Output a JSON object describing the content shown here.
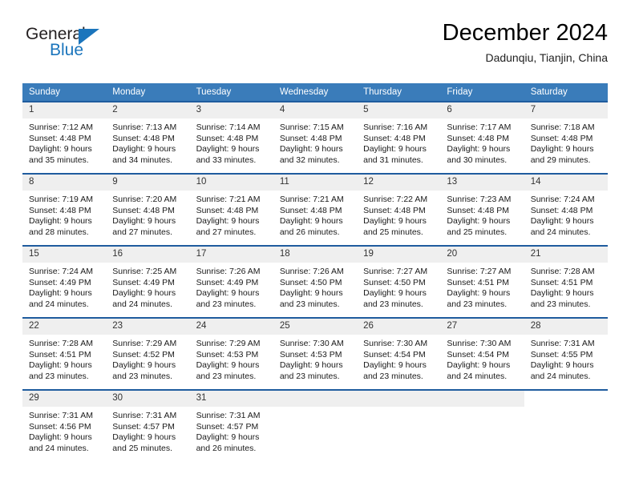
{
  "brand": {
    "name_top": "General",
    "name_bottom": "Blue",
    "accent_color": "#1b75bc",
    "triangle_icon": "triangle-icon"
  },
  "header": {
    "title": "December 2024",
    "subtitle": "Dadunqiu, Tianjin, China"
  },
  "theme": {
    "header_row_bg": "#3a7cba",
    "row_divider": "#1f5c9e",
    "daynum_bg": "#efefef",
    "text": "#1a1a1a"
  },
  "weekday_headers": [
    "Sunday",
    "Monday",
    "Tuesday",
    "Wednesday",
    "Thursday",
    "Friday",
    "Saturday"
  ],
  "labels": {
    "sunrise_prefix": "Sunrise:",
    "sunset_prefix": "Sunset:",
    "daylight_prefix": "Daylight:"
  },
  "weeks": [
    [
      {
        "day": "1",
        "sunrise": "Sunrise: 7:12 AM",
        "sunset": "Sunset: 4:48 PM",
        "daylight1": "Daylight: 9 hours",
        "daylight2": "and 35 minutes."
      },
      {
        "day": "2",
        "sunrise": "Sunrise: 7:13 AM",
        "sunset": "Sunset: 4:48 PM",
        "daylight1": "Daylight: 9 hours",
        "daylight2": "and 34 minutes."
      },
      {
        "day": "3",
        "sunrise": "Sunrise: 7:14 AM",
        "sunset": "Sunset: 4:48 PM",
        "daylight1": "Daylight: 9 hours",
        "daylight2": "and 33 minutes."
      },
      {
        "day": "4",
        "sunrise": "Sunrise: 7:15 AM",
        "sunset": "Sunset: 4:48 PM",
        "daylight1": "Daylight: 9 hours",
        "daylight2": "and 32 minutes."
      },
      {
        "day": "5",
        "sunrise": "Sunrise: 7:16 AM",
        "sunset": "Sunset: 4:48 PM",
        "daylight1": "Daylight: 9 hours",
        "daylight2": "and 31 minutes."
      },
      {
        "day": "6",
        "sunrise": "Sunrise: 7:17 AM",
        "sunset": "Sunset: 4:48 PM",
        "daylight1": "Daylight: 9 hours",
        "daylight2": "and 30 minutes."
      },
      {
        "day": "7",
        "sunrise": "Sunrise: 7:18 AM",
        "sunset": "Sunset: 4:48 PM",
        "daylight1": "Daylight: 9 hours",
        "daylight2": "and 29 minutes."
      }
    ],
    [
      {
        "day": "8",
        "sunrise": "Sunrise: 7:19 AM",
        "sunset": "Sunset: 4:48 PM",
        "daylight1": "Daylight: 9 hours",
        "daylight2": "and 28 minutes."
      },
      {
        "day": "9",
        "sunrise": "Sunrise: 7:20 AM",
        "sunset": "Sunset: 4:48 PM",
        "daylight1": "Daylight: 9 hours",
        "daylight2": "and 27 minutes."
      },
      {
        "day": "10",
        "sunrise": "Sunrise: 7:21 AM",
        "sunset": "Sunset: 4:48 PM",
        "daylight1": "Daylight: 9 hours",
        "daylight2": "and 27 minutes."
      },
      {
        "day": "11",
        "sunrise": "Sunrise: 7:21 AM",
        "sunset": "Sunset: 4:48 PM",
        "daylight1": "Daylight: 9 hours",
        "daylight2": "and 26 minutes."
      },
      {
        "day": "12",
        "sunrise": "Sunrise: 7:22 AM",
        "sunset": "Sunset: 4:48 PM",
        "daylight1": "Daylight: 9 hours",
        "daylight2": "and 25 minutes."
      },
      {
        "day": "13",
        "sunrise": "Sunrise: 7:23 AM",
        "sunset": "Sunset: 4:48 PM",
        "daylight1": "Daylight: 9 hours",
        "daylight2": "and 25 minutes."
      },
      {
        "day": "14",
        "sunrise": "Sunrise: 7:24 AM",
        "sunset": "Sunset: 4:48 PM",
        "daylight1": "Daylight: 9 hours",
        "daylight2": "and 24 minutes."
      }
    ],
    [
      {
        "day": "15",
        "sunrise": "Sunrise: 7:24 AM",
        "sunset": "Sunset: 4:49 PM",
        "daylight1": "Daylight: 9 hours",
        "daylight2": "and 24 minutes."
      },
      {
        "day": "16",
        "sunrise": "Sunrise: 7:25 AM",
        "sunset": "Sunset: 4:49 PM",
        "daylight1": "Daylight: 9 hours",
        "daylight2": "and 24 minutes."
      },
      {
        "day": "17",
        "sunrise": "Sunrise: 7:26 AM",
        "sunset": "Sunset: 4:49 PM",
        "daylight1": "Daylight: 9 hours",
        "daylight2": "and 23 minutes."
      },
      {
        "day": "18",
        "sunrise": "Sunrise: 7:26 AM",
        "sunset": "Sunset: 4:50 PM",
        "daylight1": "Daylight: 9 hours",
        "daylight2": "and 23 minutes."
      },
      {
        "day": "19",
        "sunrise": "Sunrise: 7:27 AM",
        "sunset": "Sunset: 4:50 PM",
        "daylight1": "Daylight: 9 hours",
        "daylight2": "and 23 minutes."
      },
      {
        "day": "20",
        "sunrise": "Sunrise: 7:27 AM",
        "sunset": "Sunset: 4:51 PM",
        "daylight1": "Daylight: 9 hours",
        "daylight2": "and 23 minutes."
      },
      {
        "day": "21",
        "sunrise": "Sunrise: 7:28 AM",
        "sunset": "Sunset: 4:51 PM",
        "daylight1": "Daylight: 9 hours",
        "daylight2": "and 23 minutes."
      }
    ],
    [
      {
        "day": "22",
        "sunrise": "Sunrise: 7:28 AM",
        "sunset": "Sunset: 4:51 PM",
        "daylight1": "Daylight: 9 hours",
        "daylight2": "and 23 minutes."
      },
      {
        "day": "23",
        "sunrise": "Sunrise: 7:29 AM",
        "sunset": "Sunset: 4:52 PM",
        "daylight1": "Daylight: 9 hours",
        "daylight2": "and 23 minutes."
      },
      {
        "day": "24",
        "sunrise": "Sunrise: 7:29 AM",
        "sunset": "Sunset: 4:53 PM",
        "daylight1": "Daylight: 9 hours",
        "daylight2": "and 23 minutes."
      },
      {
        "day": "25",
        "sunrise": "Sunrise: 7:30 AM",
        "sunset": "Sunset: 4:53 PM",
        "daylight1": "Daylight: 9 hours",
        "daylight2": "and 23 minutes."
      },
      {
        "day": "26",
        "sunrise": "Sunrise: 7:30 AM",
        "sunset": "Sunset: 4:54 PM",
        "daylight1": "Daylight: 9 hours",
        "daylight2": "and 23 minutes."
      },
      {
        "day": "27",
        "sunrise": "Sunrise: 7:30 AM",
        "sunset": "Sunset: 4:54 PM",
        "daylight1": "Daylight: 9 hours",
        "daylight2": "and 24 minutes."
      },
      {
        "day": "28",
        "sunrise": "Sunrise: 7:31 AM",
        "sunset": "Sunset: 4:55 PM",
        "daylight1": "Daylight: 9 hours",
        "daylight2": "and 24 minutes."
      }
    ],
    [
      {
        "day": "29",
        "sunrise": "Sunrise: 7:31 AM",
        "sunset": "Sunset: 4:56 PM",
        "daylight1": "Daylight: 9 hours",
        "daylight2": "and 24 minutes."
      },
      {
        "day": "30",
        "sunrise": "Sunrise: 7:31 AM",
        "sunset": "Sunset: 4:57 PM",
        "daylight1": "Daylight: 9 hours",
        "daylight2": "and 25 minutes."
      },
      {
        "day": "31",
        "sunrise": "Sunrise: 7:31 AM",
        "sunset": "Sunset: 4:57 PM",
        "daylight1": "Daylight: 9 hours",
        "daylight2": "and 26 minutes."
      },
      {
        "day": "",
        "sunrise": "",
        "sunset": "",
        "daylight1": "",
        "daylight2": ""
      },
      {
        "day": "",
        "sunrise": "",
        "sunset": "",
        "daylight1": "",
        "daylight2": ""
      },
      {
        "day": "",
        "sunrise": "",
        "sunset": "",
        "daylight1": "",
        "daylight2": ""
      },
      {
        "day": "",
        "sunrise": "",
        "sunset": "",
        "daylight1": "",
        "daylight2": ""
      }
    ]
  ]
}
